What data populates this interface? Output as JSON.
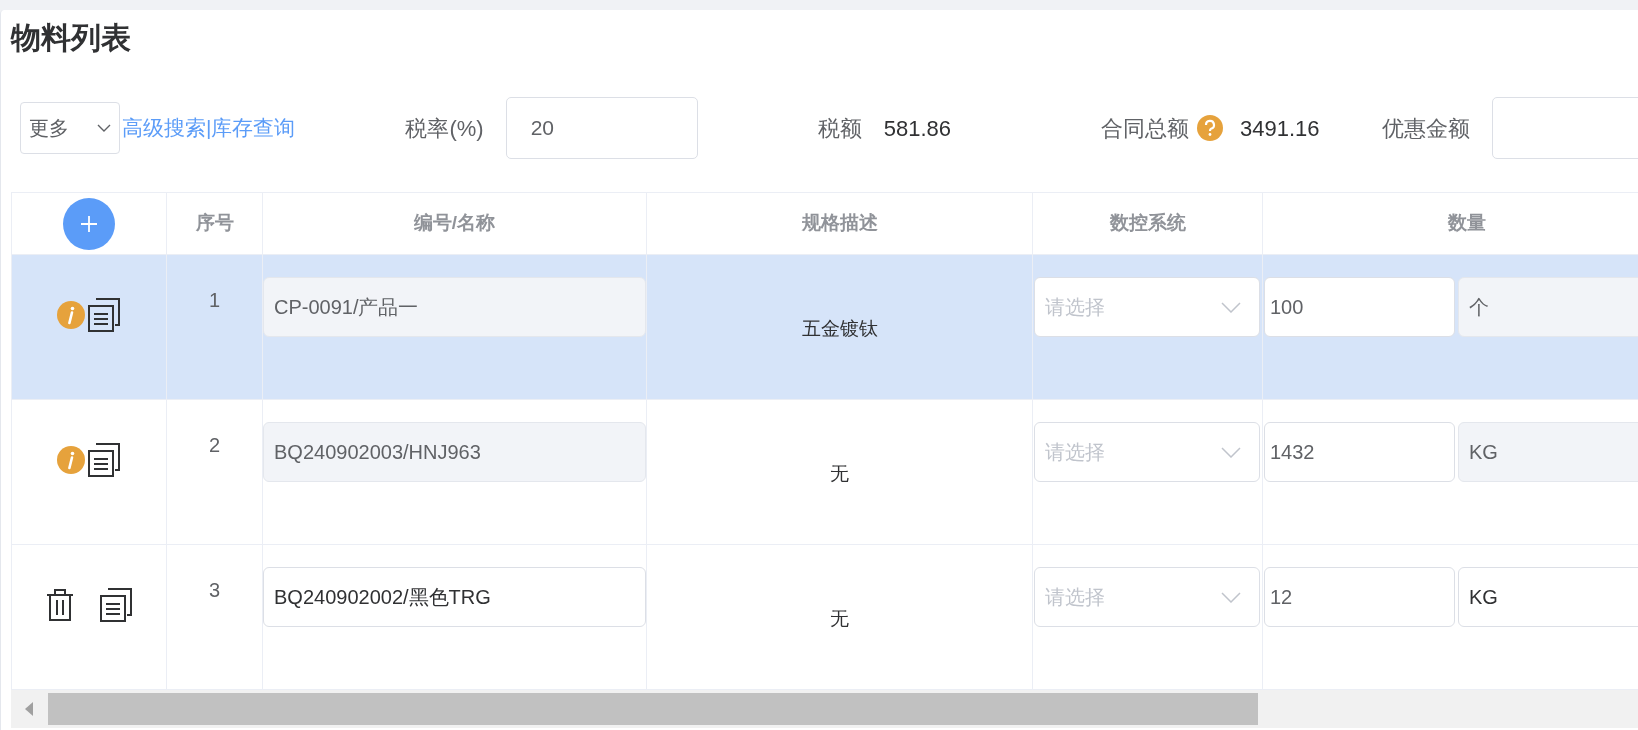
{
  "title": "物料列表",
  "toolbar": {
    "more_select": "更多",
    "links": [
      {
        "label": "高级搜索"
      },
      {
        "label": "库存查询"
      }
    ],
    "link_separator": "|",
    "tax_rate": {
      "label": "税率(%)",
      "value": "20"
    },
    "tax_amount": {
      "label": "税额",
      "value": "581.86"
    },
    "contract_total": {
      "label": "合同总额",
      "value": "3491.16",
      "help": true
    },
    "discount": {
      "label": "优惠金额"
    }
  },
  "table": {
    "columns": [
      "序号",
      "编号/名称",
      "规格描述",
      "数控系统",
      "数量"
    ],
    "rows": [
      {
        "selected": true,
        "kind": "info",
        "number": "1",
        "code_name": {
          "value": "CP-0091/产品一",
          "disabled": true
        },
        "spec": "五金镀钛",
        "cnc_system": {
          "placeholder": "请选择"
        },
        "quantity": "100",
        "unit": {
          "value": "个",
          "disabled": true
        }
      },
      {
        "selected": false,
        "kind": "info",
        "number": "2",
        "code_name": {
          "value": "BQ240902003/HNJ963",
          "disabled": true
        },
        "spec": "无",
        "cnc_system": {
          "placeholder": "请选择"
        },
        "quantity": "1432",
        "unit": {
          "value": "KG",
          "disabled": true
        }
      },
      {
        "selected": false,
        "kind": "delete",
        "number": "3",
        "code_name": {
          "value": "BQ240902002/黑色TRG",
          "disabled": false
        },
        "spec": "无",
        "cnc_system": {
          "placeholder": "请选择"
        },
        "quantity": "12",
        "unit": {
          "value": "KG",
          "disabled": false
        }
      }
    ]
  }
}
